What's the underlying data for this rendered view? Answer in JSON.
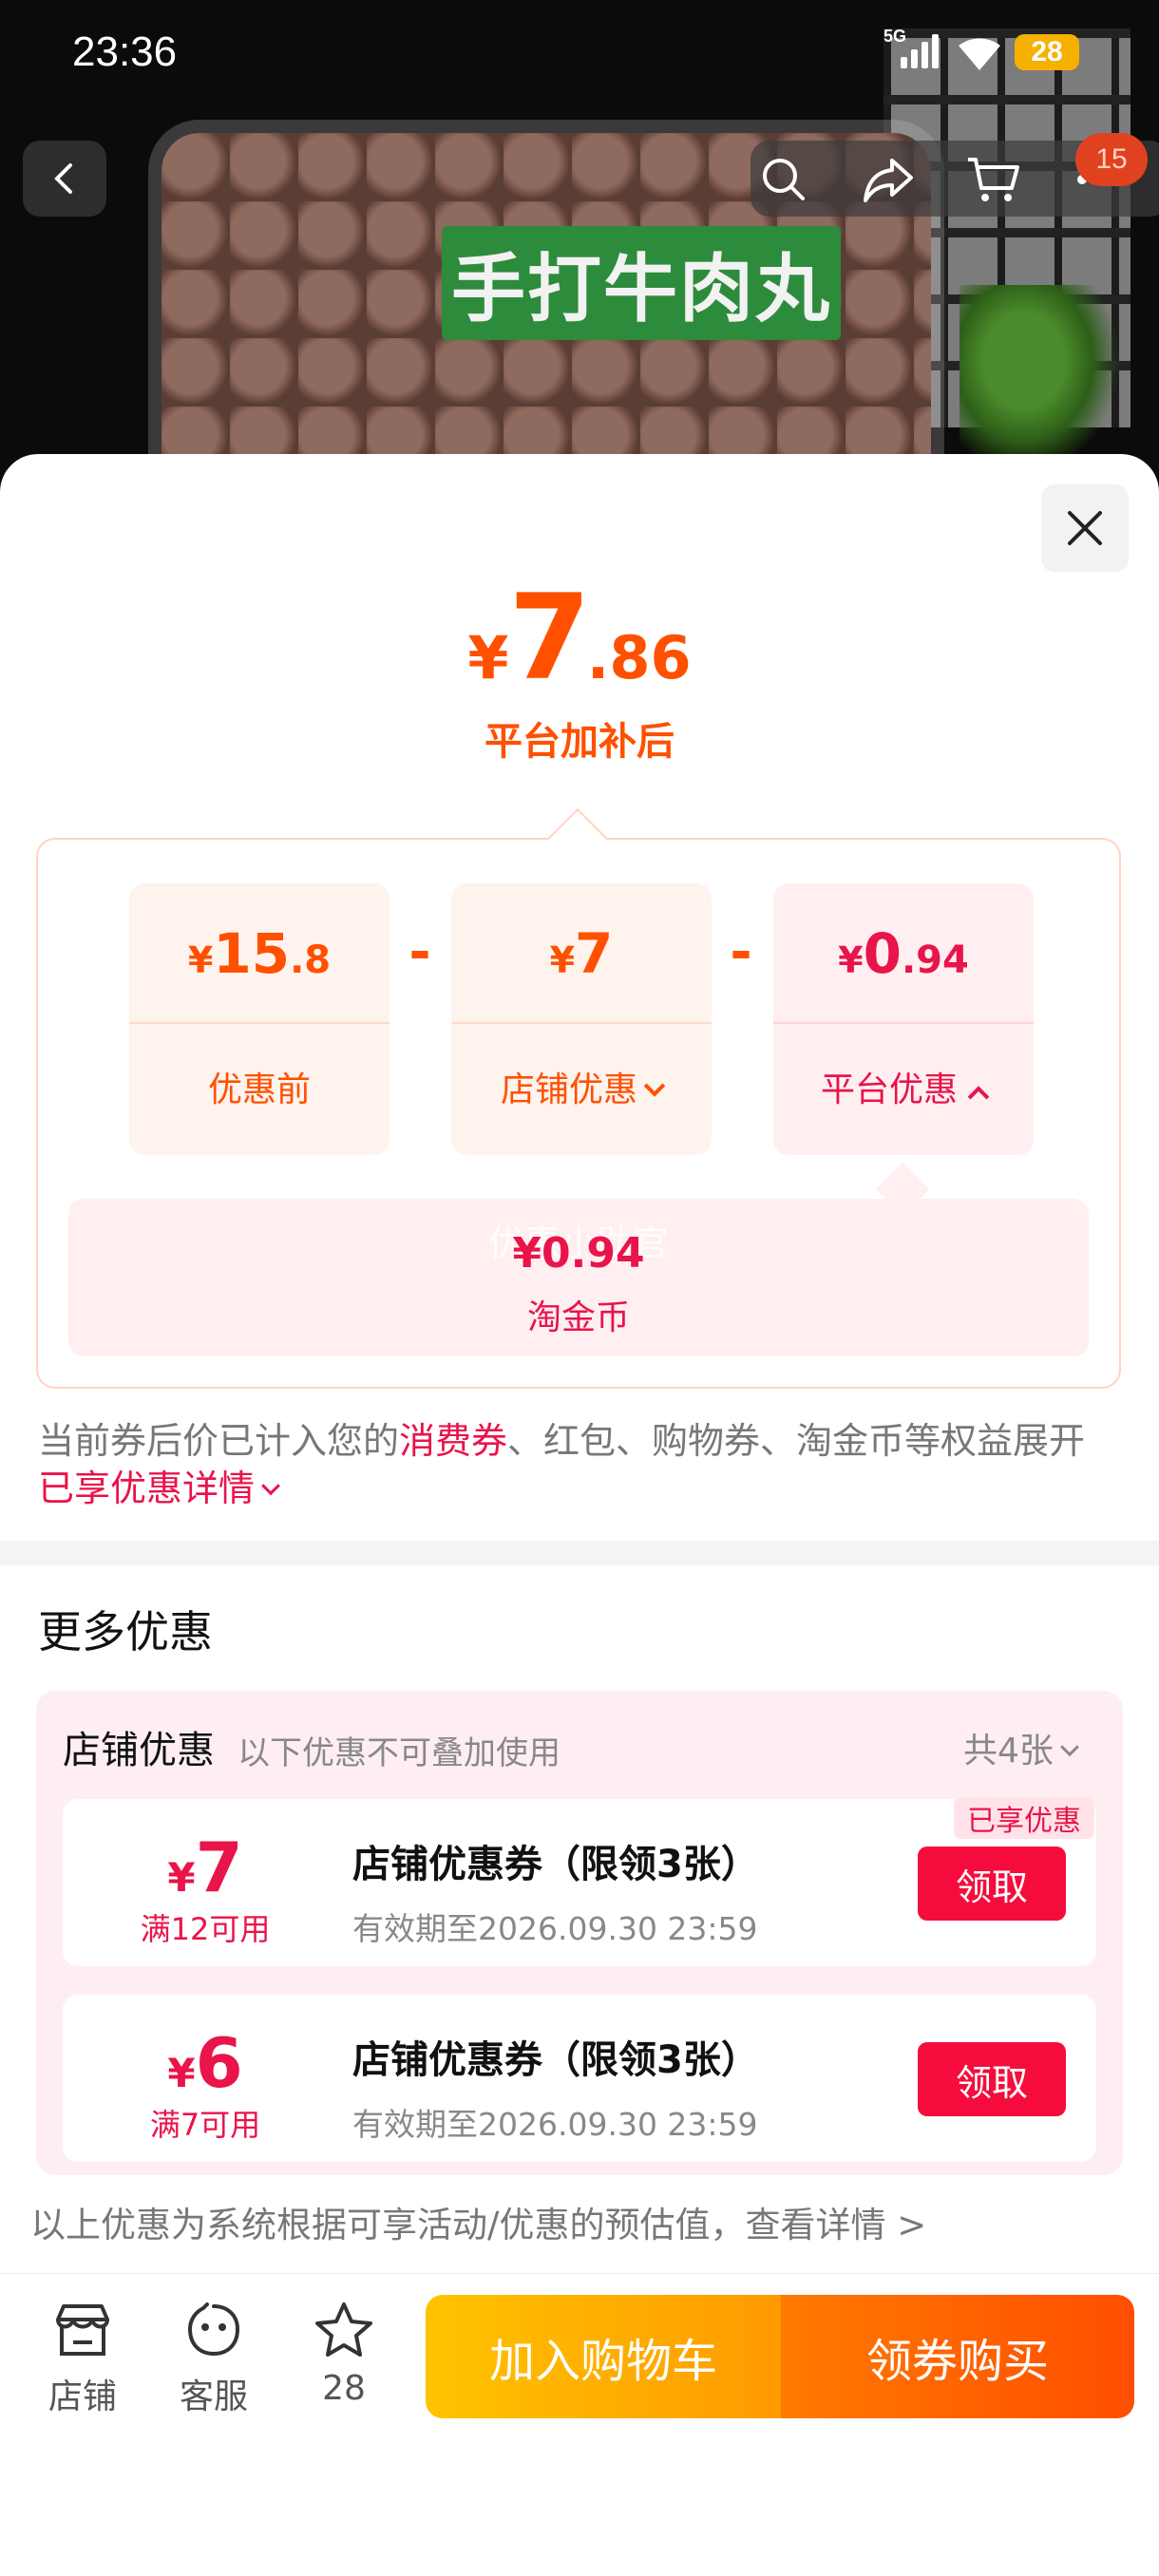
{
  "status_bar": {
    "time": "23:36",
    "network": "5G",
    "battery": "28"
  },
  "hero": {
    "product_label": "手打牛肉丸"
  },
  "top_nav": {
    "cart_badge": "15"
  },
  "price": {
    "currency": "¥",
    "integer": "7",
    "decimal": ".86",
    "caption": "平台加补后"
  },
  "breakdown": {
    "before": {
      "currency": "¥",
      "integer": "15",
      "decimal": ".8",
      "label": "优惠前"
    },
    "minus1": "-",
    "store": {
      "currency": "¥",
      "integer": "7",
      "decimal": "",
      "label": "店铺优惠"
    },
    "minus2": "-",
    "platform": {
      "currency": "¥",
      "integer": "0",
      "decimal": ".94",
      "label": "平台优惠"
    },
    "sub": {
      "watermark": "优惠小助官",
      "value": "¥0.94",
      "label": "淘金币"
    }
  },
  "note": {
    "part1": "当前券后价已计入您的",
    "highlight1": "消费券",
    "part2": "、红包、购物券、淘金币等权益展开",
    "highlight2": "已享优惠详情"
  },
  "more": {
    "title": "更多优惠",
    "store_section": {
      "title": "店铺优惠",
      "subtitle": "以下优惠不可叠加使用",
      "count": "共4张"
    },
    "coupons": [
      {
        "currency": "¥",
        "amount": "7",
        "condition": "满12可用",
        "name": "店铺优惠券（限领3张）",
        "expiry": "有效期至2026.09.30 23:59",
        "button": "领取",
        "tag": "已享优惠"
      },
      {
        "currency": "¥",
        "amount": "6",
        "condition": "满7可用",
        "name": "店铺优惠券（限领3张）",
        "expiry": "有效期至2026.09.30 23:59",
        "button": "领取",
        "tag": ""
      }
    ],
    "disclaimer": "以上优惠为系统根据可享活动/优惠的预估值，查看详情 >"
  },
  "action_bar": {
    "store_label": "店铺",
    "service_label": "客服",
    "favorite_count": "28",
    "add_to_cart": "加入购物车",
    "buy": "领券购买"
  },
  "colors": {
    "accent_orange": "#ff5000",
    "accent_red": "#e8144a"
  }
}
